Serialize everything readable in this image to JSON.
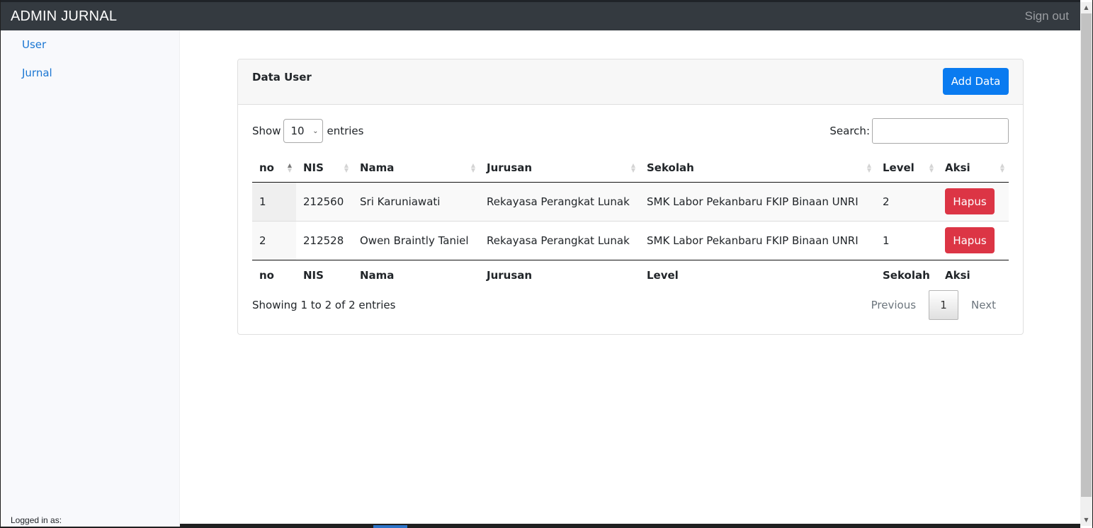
{
  "navbar": {
    "brand": "ADMIN JURNAL",
    "signout": "Sign out"
  },
  "sidebar": {
    "items": [
      {
        "label": "User"
      },
      {
        "label": "Jurnal"
      }
    ],
    "logged_in": "Logged in as:"
  },
  "card": {
    "title": "Data User",
    "add_button": "Add Data"
  },
  "controls": {
    "show_label": "Show",
    "show_value": "10",
    "entries_label": "entries",
    "search_label": "Search:",
    "search_value": ""
  },
  "table": {
    "headers": [
      "no",
      "NIS",
      "Nama",
      "Jurusan",
      "Sekolah",
      "Level",
      "Aksi"
    ],
    "footers": [
      "no",
      "NIS",
      "Nama",
      "Jurusan",
      "Level",
      "Sekolah",
      "Aksi"
    ],
    "rows": [
      {
        "no": "1",
        "nis": "212560",
        "nama": "Sri Karuniawati",
        "jurusan": "Rekayasa Perangkat Lunak",
        "sekolah": "SMK Labor Pekanbaru FKIP Binaan UNRI",
        "level": "2",
        "aksi": "Hapus"
      },
      {
        "no": "2",
        "nis": "212528",
        "nama": "Owen Braintly Taniel",
        "jurusan": "Rekayasa Perangkat Lunak",
        "sekolah": "SMK Labor Pekanbaru FKIP Binaan UNRI",
        "level": "1",
        "aksi": "Hapus"
      }
    ]
  },
  "footer": {
    "info": "Showing 1 to 2 of 2 entries",
    "previous": "Previous",
    "current_page": "1",
    "next": "Next"
  },
  "colors": {
    "navbar": "#343a40",
    "primary": "#0a7bf0",
    "danger": "#dc3545",
    "link": "#1a76d2"
  }
}
